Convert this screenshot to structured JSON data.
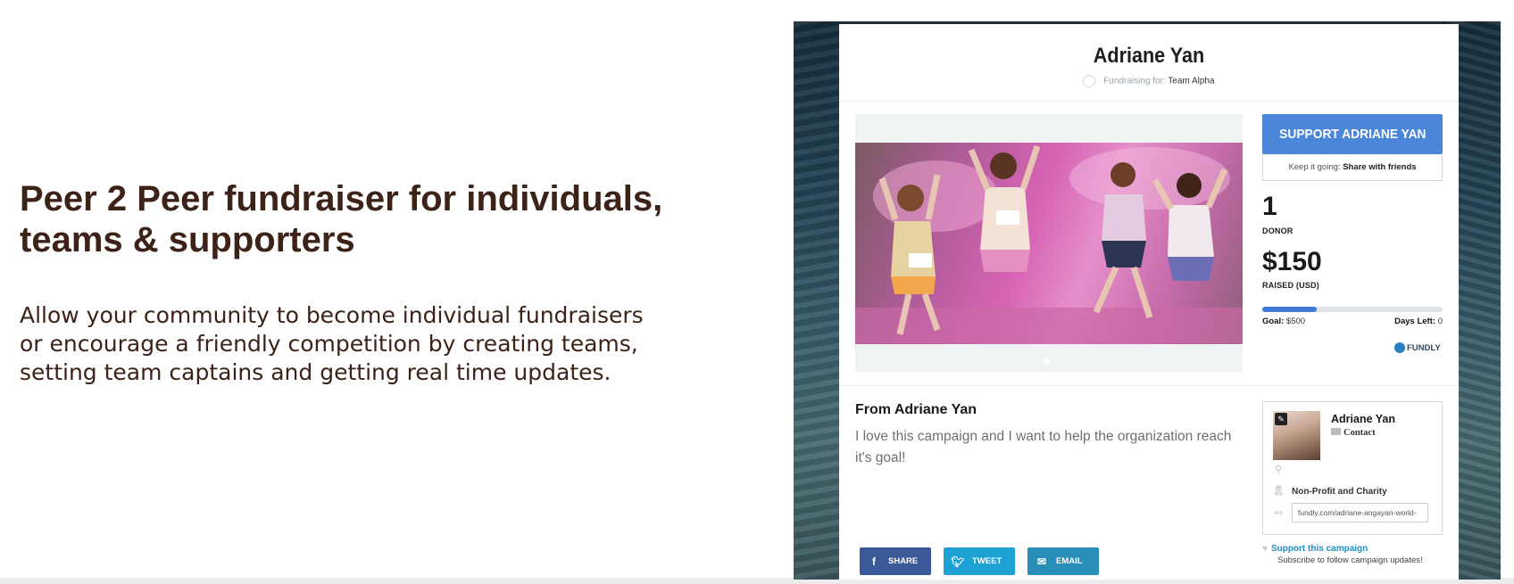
{
  "hero": {
    "heading": "Peer 2 Peer fundraiser for individuals, teams & supporters",
    "text": "Allow your community to become individual fundraisers or encourage a friendly competition by creating teams, setting team captains and getting real time updates."
  },
  "campaign": {
    "fundraiser_name": "Adriane Yan",
    "fundraising_for_label": "Fundraising for:",
    "team_name": "Team Alpha",
    "support_button": "SUPPORT ADRIANE YAN",
    "keep_going_label": "Keep it going:",
    "share_with_friends": "Share with friends",
    "donor_count": "1",
    "donor_label": "DONOR",
    "raised_amount": "$150",
    "raised_label": "RAISED (USD)",
    "progress_fraction": 0.3,
    "goal_label": "Goal:",
    "goal_value": "$500",
    "days_left_label": "Days Left:",
    "days_left_value": "0",
    "brand": "FUNDLY"
  },
  "story": {
    "title": "From Adriane Yan",
    "text": "I love this campaign and I want to help the organization reach it's goal!"
  },
  "profile": {
    "name": "Adriane Yan",
    "contact_label": "Contact",
    "category": "Non-Profit and Charity",
    "url": "fundly.com/adriane-angayan-world-"
  },
  "support": {
    "link": "Support this campaign",
    "subscribe": "Subscribe to follow campaign updates!"
  },
  "social": {
    "share": "SHARE",
    "tweet": "TWEET",
    "email": "EMAIL"
  },
  "icons": {
    "facebook": "facebook-icon",
    "twitter": "twitter-icon",
    "email": "envelope-icon",
    "location": "map-pin-icon",
    "category": "ribbon-icon",
    "link": "link-icon",
    "heart": "heart-icon",
    "edit": "pencil-icon"
  },
  "colors": {
    "heading": "#3d2218",
    "support_button": "#4a86d9",
    "progress": "#3f78d8",
    "facebook": "#3b5998",
    "twitter": "#1da1d4",
    "email": "#2a8fb8",
    "link": "#1f8ec2"
  }
}
